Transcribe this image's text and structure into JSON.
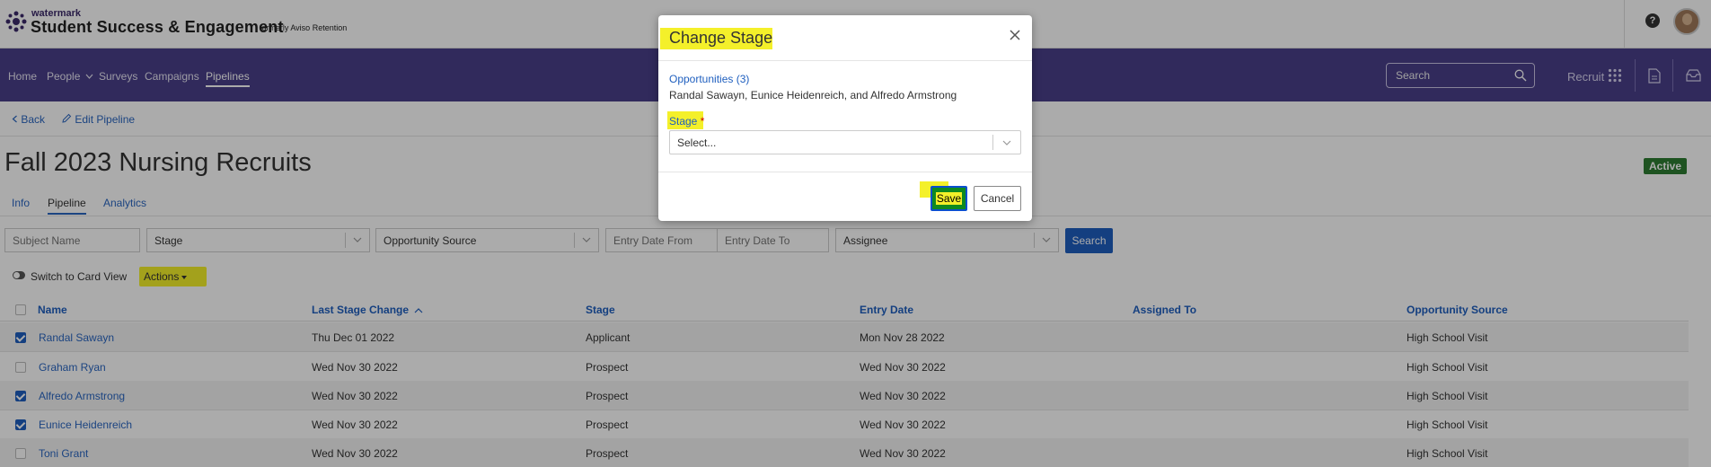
{
  "header": {
    "brand_small": "watermark",
    "brand_name": "Student Success & Engagement",
    "brand_sub": "| formerly Aviso Retention",
    "help_glyph": "?"
  },
  "nav": {
    "items": [
      "Home",
      "People",
      "Surveys",
      "Campaigns",
      "Pipelines"
    ],
    "active": "Pipelines",
    "search_placeholder": "Search",
    "recruit_label": "Recruit"
  },
  "breadcrumb": {
    "back": "Back",
    "edit": "Edit Pipeline"
  },
  "page": {
    "title": "Fall 2023 Nursing Recruits",
    "status": "Active",
    "tabs": [
      "Info",
      "Pipeline",
      "Analytics"
    ],
    "active_tab": "Pipeline"
  },
  "filters": {
    "subject_placeholder": "Subject Name",
    "stage": "Stage",
    "opportunity_source": "Opportunity Source",
    "entry_from_placeholder": "Entry Date From",
    "entry_to_placeholder": "Entry Date To",
    "assignee": "Assignee",
    "search_button": "Search"
  },
  "toolbar": {
    "switch_view": "Switch to Card View",
    "actions": "Actions"
  },
  "table": {
    "headers": [
      "Name",
      "Last Stage Change",
      "Stage",
      "Entry Date",
      "Assigned To",
      "Opportunity Source"
    ],
    "rows": [
      {
        "checked": true,
        "name": "Randal Sawayn",
        "last_change": "Thu Dec 01 2022",
        "stage": "Applicant",
        "entry": "Mon Nov 28 2022",
        "assigned": "",
        "source": "High School Visit"
      },
      {
        "checked": false,
        "name": "Graham Ryan",
        "last_change": "Wed Nov 30 2022",
        "stage": "Prospect",
        "entry": "Wed Nov 30 2022",
        "assigned": "",
        "source": "High School Visit"
      },
      {
        "checked": true,
        "name": "Alfredo Armstrong",
        "last_change": "Wed Nov 30 2022",
        "stage": "Prospect",
        "entry": "Wed Nov 30 2022",
        "assigned": "",
        "source": "High School Visit"
      },
      {
        "checked": true,
        "name": "Eunice Heidenreich",
        "last_change": "Wed Nov 30 2022",
        "stage": "Prospect",
        "entry": "Wed Nov 30 2022",
        "assigned": "",
        "source": "High School Visit"
      },
      {
        "checked": false,
        "name": "Toni Grant",
        "last_change": "Wed Nov 30 2022",
        "stage": "Prospect",
        "entry": "Wed Nov 30 2022",
        "assigned": "",
        "source": "High School Visit"
      }
    ]
  },
  "modal": {
    "title": "Change Stage",
    "opportunities_label": "Opportunities (3)",
    "selected_names": "Randal Sawayn, Eunice Heidenreich, and Alfredo Armstrong",
    "stage_label": "Stage",
    "required_mark": "*",
    "stage_placeholder": "Select...",
    "save": "Save",
    "cancel": "Cancel"
  },
  "colors": {
    "nav_purple": "#4a3f8a",
    "link_blue": "#1f5fbf",
    "highlight_yellow": "#f4f02a",
    "save_green": "#0f8a1f",
    "status_green": "#2e7d32"
  }
}
